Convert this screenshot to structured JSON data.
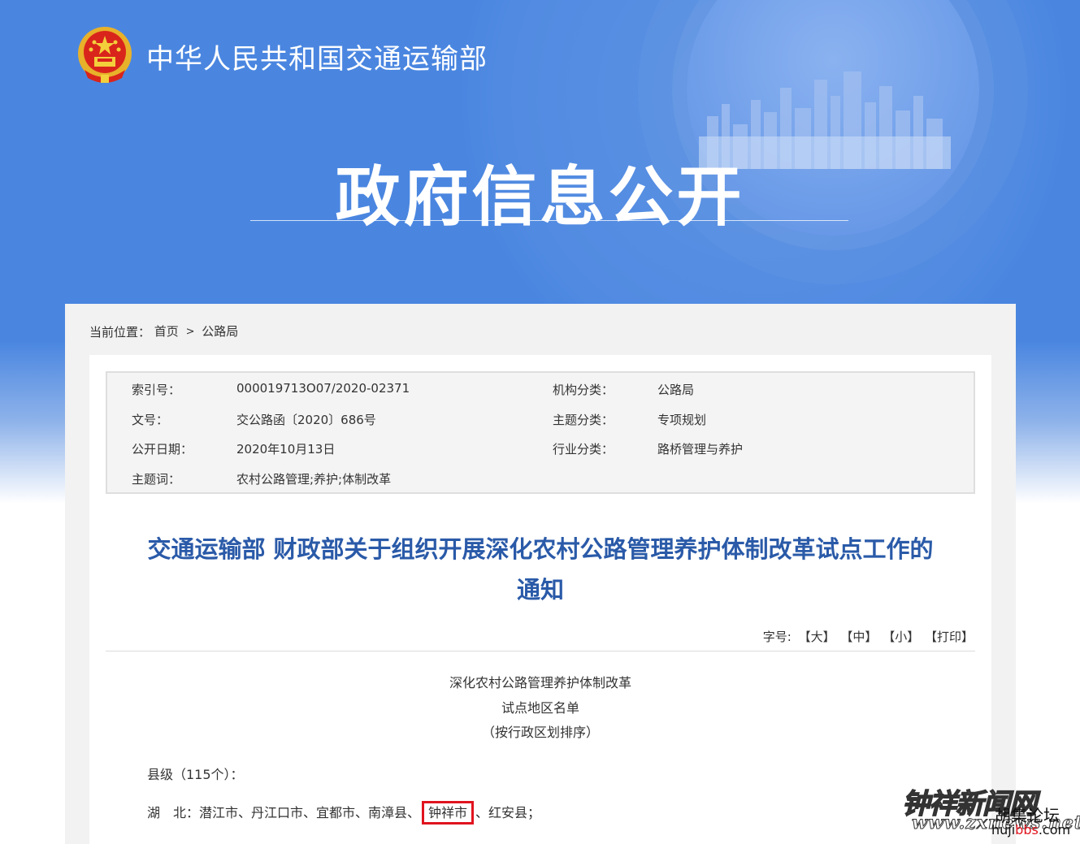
{
  "header": {
    "ministry_name": "中华人民共和国交通运输部",
    "section_title": "政府信息公开",
    "emblem_icon": "national-emblem-icon"
  },
  "breadcrumb": {
    "label": "当前位置：",
    "home": "首页",
    "separator": ">",
    "current": "公路局"
  },
  "meta": {
    "index_no_label": "索引号：",
    "index_no": "000019713O07/2020-02371",
    "doc_no_label": "文号：",
    "doc_no": "交公路函〔2020〕686号",
    "publish_date_label": "公开日期：",
    "publish_date": "2020年10月13日",
    "keywords_label": "主题词：",
    "keywords": "农村公路管理;养护;体制改革",
    "org_label": "机构分类：",
    "org": "公路局",
    "topic_label": "主题分类：",
    "topic": "专项规划",
    "industry_label": "行业分类：",
    "industry": "路桥管理与养护"
  },
  "article": {
    "title_line1": "交通运输部 财政部关于组织开展深化农村公路管理养护体制改革试点工作的",
    "title_line2": "通知",
    "font_size_label": "字号:",
    "font_large": "【大】",
    "font_medium": "【中】",
    "font_small": "【小】",
    "print": "【打印】",
    "list_heading_1": "深化农村公路管理养护体制改革",
    "list_heading_2": "试点地区名单",
    "list_heading_3": "（按行政区划排序）",
    "county_level": "县级（115个）：",
    "hubei_prefix": "湖　北：潜江市、丹江口市、宜都市、南漳县、",
    "hubei_highlight": "钟祥市",
    "hubei_suffix": "、红安县；"
  },
  "watermark": {
    "site_name": "钟祥新闻网",
    "site_url": "www.zxnews.net",
    "forum_name": "胡集论坛",
    "forum_url_prefix": "huji",
    "forum_url_bbs": "bbs",
    "forum_url_suffix": ".com"
  },
  "colors": {
    "banner_blue": "#4a86e0",
    "title_blue": "#2a5aa8",
    "highlight_red": "#e0141e"
  }
}
